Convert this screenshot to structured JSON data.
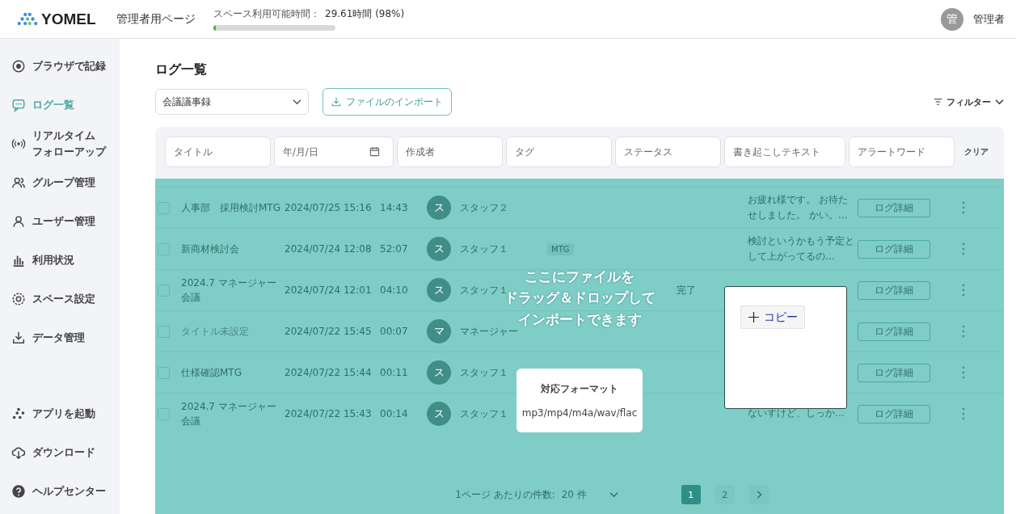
{
  "header": {
    "logo": "YOMEL",
    "page_title": "管理者用ページ",
    "usage": {
      "label": "スペース利用可能時間：",
      "value": "29.61時間 (98%)",
      "level": 0.02
    },
    "avatar": "管",
    "user": "管理者"
  },
  "sidebar": {
    "items": [
      {
        "lines": [
          "ブラウザで記録"
        ],
        "selected": false
      },
      {
        "lines": [
          "ログ一覧"
        ],
        "selected": true
      },
      {
        "lines": [
          "リアルタイム",
          "フォローアップ"
        ],
        "selected": false
      },
      {
        "lines": [
          "グループ管理"
        ],
        "selected": false
      },
      {
        "lines": [
          "ユーザー管理"
        ],
        "selected": false
      },
      {
        "lines": [
          "利用状況"
        ],
        "selected": false
      },
      {
        "lines": [
          "スペース設定"
        ],
        "selected": false
      },
      {
        "lines": [
          "データ管理"
        ],
        "selected": false
      }
    ],
    "bottom_items": [
      {
        "label": "アプリを起動"
      },
      {
        "label": "ダウンロード"
      },
      {
        "label": "ヘルプセンター"
      }
    ]
  },
  "page": {
    "title": "ログ一覧",
    "category_select": "会議議事録",
    "import_button": "ファイルのインポート",
    "filter_button": "フィルター"
  },
  "filters": {
    "fields": [
      {
        "placeholder": "タイトル",
        "kind": "text"
      },
      {
        "placeholder": "年/月/日",
        "kind": "date"
      },
      {
        "placeholder": "作成者",
        "kind": "text"
      },
      {
        "placeholder": "タグ",
        "kind": "text"
      },
      {
        "placeholder": "ステータス",
        "kind": "text"
      },
      {
        "placeholder": "書き起こしテキスト",
        "kind": "text"
      },
      {
        "placeholder": "アラートワード",
        "kind": "text"
      }
    ],
    "clear": "クリア"
  },
  "table": {
    "rows": [
      {
        "checked": false,
        "untitled": false,
        "title": "人事部　採用検討MTG",
        "date": "2024/07/25 15:16",
        "duration": "14:43",
        "avatar": "ス",
        "author": "スタッフ２",
        "tag": "",
        "status": "",
        "transcript": "お疲れ様です。 お待たせしました。 かい。…",
        "detail": "ログ詳細"
      },
      {
        "checked": false,
        "untitled": false,
        "title": "新商材検討会",
        "date": "2024/07/24 12:08",
        "duration": "52:07",
        "avatar": "ス",
        "author": "スタッフ１",
        "tag": "MTG",
        "status": "",
        "transcript": "検討というかもう予定として上がってるの…",
        "detail": "ログ詳細"
      },
      {
        "checked": false,
        "untitled": false,
        "title": "2024.7 マネージャー会議",
        "date": "2024/07/24 12:01",
        "duration": "04:10",
        "avatar": "ス",
        "author": "スタッフ１",
        "tag": "",
        "status": "完了",
        "transcript": "",
        "detail": "ログ詳細"
      },
      {
        "checked": false,
        "untitled": true,
        "title": "タイトル未設定",
        "date": "2024/07/22 15:45",
        "duration": "00:07",
        "avatar": "マ",
        "author": "マネージャー",
        "tag": "",
        "status": "",
        "transcript": "",
        "detail": "ログ詳細"
      },
      {
        "checked": false,
        "untitled": false,
        "title": "仕様確認MTG",
        "date": "2024/07/22 15:44",
        "duration": "00:11",
        "avatar": "ス",
        "author": "スタッフ１",
        "tag": "",
        "status": "",
        "transcript": "",
        "detail": "ログ詳細"
      },
      {
        "checked": false,
        "untitled": false,
        "title": "2024.7 マネージャー会議",
        "date": "2024/07/22 15:43",
        "duration": "00:14",
        "avatar": "ス",
        "author": "スタッフ１",
        "tag": "",
        "status": "",
        "transcript": "ないすけど、しっか…",
        "detail": "ログ詳細"
      }
    ],
    "per_page_label": "1ページ あたりの件数:",
    "per_page": "20 件",
    "pages": [
      {
        "label": "1",
        "selected": true
      },
      {
        "label": "2",
        "selected": false
      }
    ]
  },
  "drop_overlay": {
    "message_lines": [
      "ここにファイルを",
      "ドラッグ＆ドロップして",
      "インポートできます"
    ],
    "formats_title": "対応フォーマット",
    "formats": "mp3/mp4/m4a/wav/flac"
  },
  "context_menu": {
    "item": "コピー"
  }
}
